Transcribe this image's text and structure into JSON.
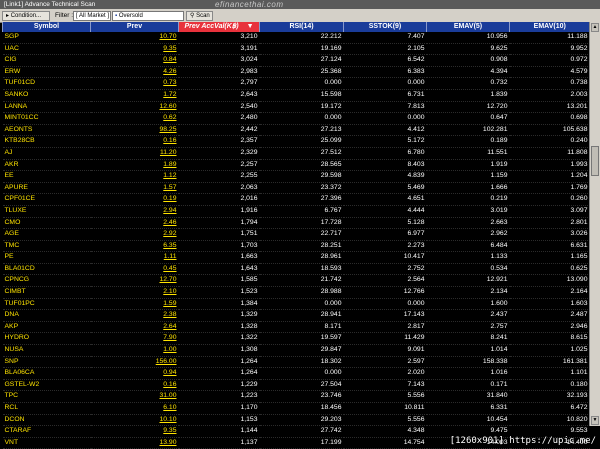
{
  "window": {
    "title": "[Link1] Advance Technical Scan",
    "watermark": "efinancethai.com"
  },
  "toolbar": {
    "condition_label": "Condition...",
    "filter_label": "Filter :",
    "filter_value": "[ All Market ]",
    "scan_type": "Oversold",
    "scan_label": "Scan"
  },
  "columns": [
    "Symbol",
    "Prev",
    "Prev AccVal(K฿)",
    "RSI(14)",
    "SSTOK(9)",
    "EMAV(5)",
    "EMAV(10)"
  ],
  "sorted_column_index": 2,
  "rows": [
    [
      "SGP",
      "10.70",
      "3,210",
      "22.212",
      "7.407",
      "10.956",
      "11.188"
    ],
    [
      "UAC",
      "9.35",
      "3,191",
      "19.169",
      "2.105",
      "9.625",
      "9.952"
    ],
    [
      "CIG",
      "0.84",
      "3,024",
      "27.124",
      "6.542",
      "0.908",
      "0.972"
    ],
    [
      "ERW",
      "4.26",
      "2,983",
      "25.368",
      "6.383",
      "4.394",
      "4.579"
    ],
    [
      "TUF01CD",
      "0.73",
      "2,797",
      "0.000",
      "0.000",
      "0.732",
      "0.738"
    ],
    [
      "SANKO",
      "1.72",
      "2,643",
      "15.598",
      "6.731",
      "1.839",
      "2.003"
    ],
    [
      "LANNA",
      "12.60",
      "2,540",
      "19.172",
      "7.813",
      "12.720",
      "13.201"
    ],
    [
      "MINT01CC",
      "0.62",
      "2,480",
      "0.000",
      "0.000",
      "0.647",
      "0.698"
    ],
    [
      "AEONTS",
      "98.25",
      "2,442",
      "27.213",
      "4.412",
      "102.281",
      "105.638"
    ],
    [
      "KTB28CB",
      "0.16",
      "2,357",
      "25.099",
      "5.172",
      "0.189",
      "0.240"
    ],
    [
      "AJ",
      "11.20",
      "2,329",
      "27.512",
      "6.780",
      "11.551",
      "11.808"
    ],
    [
      "AKR",
      "1.89",
      "2,257",
      "28.565",
      "8.403",
      "1.919",
      "1.993"
    ],
    [
      "EE",
      "1.12",
      "2,255",
      "29.598",
      "4.839",
      "1.159",
      "1.204"
    ],
    [
      "APURE",
      "1.57",
      "2,063",
      "23.372",
      "5.469",
      "1.666",
      "1.769"
    ],
    [
      "CPF01CE",
      "0.19",
      "2,016",
      "27.396",
      "4.651",
      "0.219",
      "0.260"
    ],
    [
      "TLUXE",
      "2.94",
      "1,916",
      "6.767",
      "4.444",
      "3.019",
      "3.097"
    ],
    [
      "CMO",
      "2.46",
      "1,794",
      "17.728",
      "5.128",
      "2.663",
      "2.801"
    ],
    [
      "AGE",
      "2.92",
      "1,751",
      "22.717",
      "6.977",
      "2.962",
      "3.026"
    ],
    [
      "TMC",
      "6.35",
      "1,703",
      "28.251",
      "2.273",
      "6.484",
      "6.631"
    ],
    [
      "PE",
      "1.11",
      "1,663",
      "28.961",
      "10.417",
      "1.133",
      "1.165"
    ],
    [
      "BLA01CD",
      "0.45",
      "1,643",
      "18.593",
      "2.752",
      "0.534",
      "0.625"
    ],
    [
      "CPNCG",
      "12.70",
      "1,585",
      "21.742",
      "2.564",
      "12.921",
      "13.090"
    ],
    [
      "CIMBT",
      "2.10",
      "1,523",
      "28.988",
      "12.766",
      "2.134",
      "2.164"
    ],
    [
      "TUF01PC",
      "1.59",
      "1,384",
      "0.000",
      "0.000",
      "1.600",
      "1.603"
    ],
    [
      "DNA",
      "2.38",
      "1,329",
      "28.941",
      "17.143",
      "2.437",
      "2.487"
    ],
    [
      "AKP",
      "2.64",
      "1,328",
      "8.171",
      "2.817",
      "2.757",
      "2.946"
    ],
    [
      "HYDRO",
      "7.90",
      "1,322",
      "19.597",
      "11.429",
      "8.241",
      "8.615"
    ],
    [
      "NUSA",
      "1.00",
      "1,308",
      "29.847",
      "9.091",
      "1.014",
      "1.025"
    ],
    [
      "SNP",
      "156.00",
      "1,264",
      "18.302",
      "2.597",
      "158.338",
      "161.381"
    ],
    [
      "BLA06CA",
      "0.94",
      "1,264",
      "0.000",
      "2.020",
      "1.016",
      "1.101"
    ],
    [
      "GSTEL-W2",
      "0.16",
      "1,229",
      "27.504",
      "7.143",
      "0.171",
      "0.180"
    ],
    [
      "TPC",
      "31.00",
      "1,223",
      "23.746",
      "5.556",
      "31.840",
      "32.193"
    ],
    [
      "RCL",
      "6.10",
      "1,170",
      "18.456",
      "10.811",
      "6.331",
      "6.472"
    ],
    [
      "DCON",
      "10.10",
      "1,153",
      "29.203",
      "5.556",
      "10.454",
      "10.820"
    ],
    [
      "CTARAF",
      "9.35",
      "1,144",
      "27.742",
      "4.348",
      "9.475",
      "9.553"
    ],
    [
      "VNT",
      "13.90",
      "1,137",
      "17.199",
      "14.754",
      "14.003",
      "14.400"
    ]
  ],
  "caption": "[1260x901] https://upic.me/"
}
